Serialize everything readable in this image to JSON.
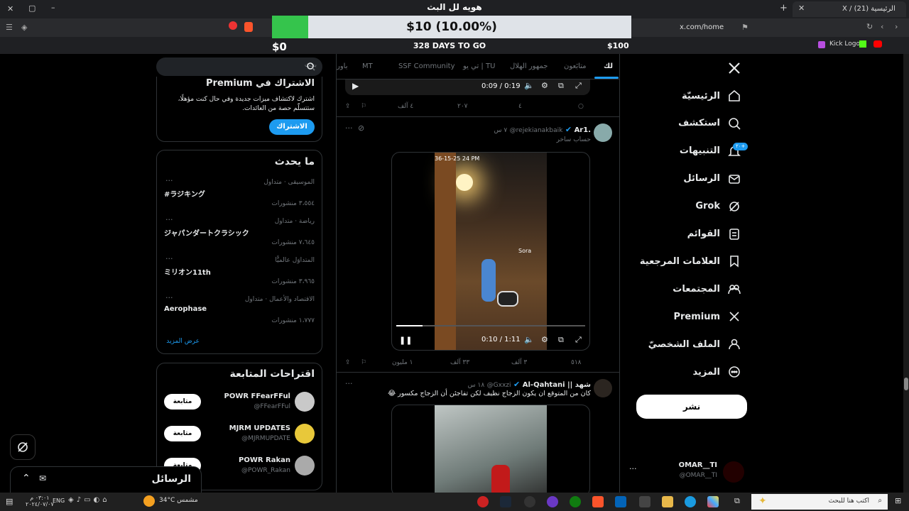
{
  "stream": {
    "title": "هويه لل البث",
    "donation_amount": "$10 (10.00%)",
    "donation_progress": 0.1,
    "goal_start": "$0",
    "goal_end": "$100",
    "days_to_go": "328 DAYS TO GO"
  },
  "browser": {
    "tab_title": "X / (21) الرئيسية",
    "url": "x.com/home",
    "bookmark_label": "Kick Logo"
  },
  "feed_tabs": [
    "لك",
    "متابَعون",
    "جمهور الهلال",
    "تي يو | TU",
    "SSF Community",
    "MT",
    "باور"
  ],
  "post1": {
    "time": "0:09 / 0:19",
    "replies": "",
    "reposts": "٤",
    "likes": "٢٠٧",
    "views": "٤ آلف"
  },
  "post2": {
    "name": "Ar1.",
    "handle": "@rejekianakbaik",
    "time": "٧ س",
    "label": "حساب ساخر",
    "video_timestamp": "36-15-25 24 PM",
    "sora": "Sora",
    "video_time": "0:10 / 1:11",
    "replies": "٥١٨",
    "reposts": "٣ آلف",
    "likes": "٣٣ آلف",
    "views": "١ مليون"
  },
  "post3": {
    "name": "Al-Qahtani || شهد",
    "handle": "@Gxxzi",
    "time": "١٨ س",
    "text": "كان من المتوقع ان يكون الزجاج نظيف لكن تفاجئن أن الزجاج مكسور 😂"
  },
  "search": {
    "placeholder": "بحث"
  },
  "premium": {
    "title": "الاشتراك في Premium",
    "body": "اشترك لاكتشاف ميزات جديدة وفي حال كنت مؤهلًا، ستتسلّم حصة من العائدات.",
    "button": "الاشتراك"
  },
  "trends": {
    "title": "ما يحدث",
    "items": [
      {
        "context": "الموسيقى · متداول",
        "name": "#ラジキング",
        "count": "٣،٥٥٤ منشورات"
      },
      {
        "context": "رياضة · متداول",
        "name": "ジャパンダートクラシック",
        "count": "٧،٦٤٥ منشورات"
      },
      {
        "context": "المتداوَل عالميًّا",
        "name": "ミリオン11th",
        "count": "٣،٩٦٥ منشورات"
      },
      {
        "context": "الاقتصاد والأعمال · متداول",
        "name": "Aerophase",
        "count": "١،٧٧٧ منشورات"
      }
    ],
    "show_more": "عرض المزيد"
  },
  "follow": {
    "title": "اقتراحات المتابعة",
    "button": "متابعة",
    "items": [
      {
        "name": "POWR FFearFFul",
        "handle": "@FFearFFul"
      },
      {
        "name": "MJRM UPDATES",
        "handle": "@MJRMUPDATE"
      },
      {
        "name": "POWR Rakan",
        "handle": "@POWR_Rakan"
      }
    ]
  },
  "messages_bar": {
    "label": "الرسائل"
  },
  "nav": {
    "home": "الرئيسيّة",
    "explore": "استكشف",
    "notifications": "التنبيهات",
    "notif_badge": "٢٠+",
    "messages": "الرسائل",
    "grok": "Grok",
    "lists": "القوائم",
    "bookmarks": "العلامات المرجعية",
    "communities": "المجتمعات",
    "premium": "Premium",
    "profile": "الملف الشخصيّ",
    "more": "المزيد",
    "post_button": "نشر"
  },
  "account": {
    "name": "OMAR__TI",
    "handle": "@OMAR__TI"
  },
  "taskbar": {
    "search_placeholder": "اكتب هنا للبحث",
    "weather": "34°C مشمس",
    "time": "٠٣:٠١ م",
    "date": "٢٠٢٤/٠٧/٠٧",
    "lang": "ENG"
  },
  "colors": {
    "accent": "#1d9bf0",
    "progress_fill": "#35c44c"
  }
}
